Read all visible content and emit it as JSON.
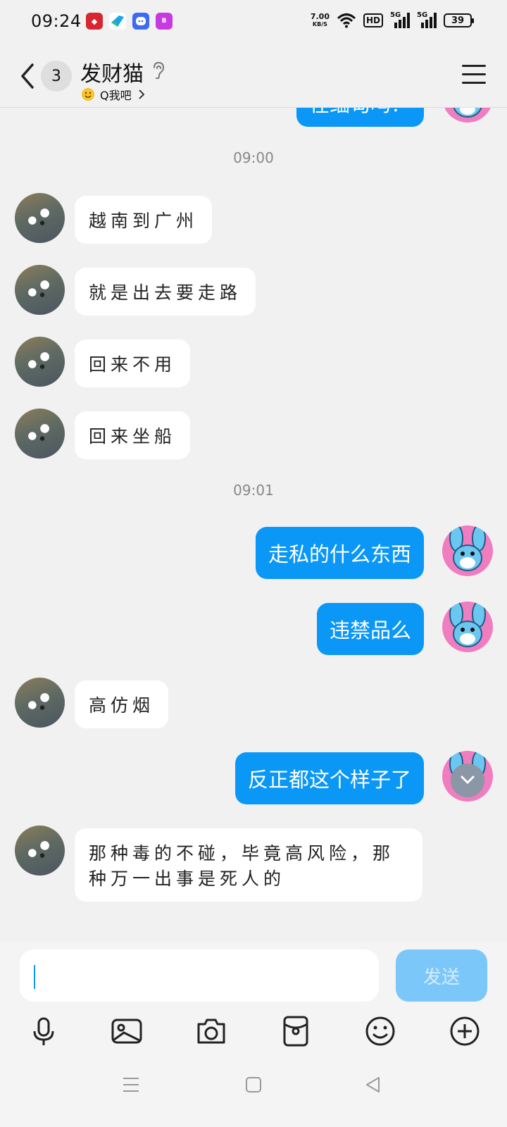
{
  "status_bar": {
    "time": "09:24",
    "net_speed_value": "7.00",
    "net_speed_unit": "KB/S",
    "hd_label": "HD",
    "sim1_label": "5G",
    "sim2_label": "5G",
    "battery": "39",
    "app_icons": [
      "app-icon-red",
      "app-icon-bird",
      "app-icon-qq",
      "app-icon-bank"
    ]
  },
  "header": {
    "unread_count": "3",
    "contact_name": "发财猫",
    "subtitle": "Q我吧"
  },
  "messages": [
    {
      "side": "right",
      "text": "在缅甸吗？",
      "partial": true
    },
    {
      "type": "timestamp",
      "text": "09:00"
    },
    {
      "side": "left",
      "text": "越南到广州"
    },
    {
      "side": "left",
      "text": "就是出去要走路"
    },
    {
      "side": "left",
      "text": "回来不用"
    },
    {
      "side": "left",
      "text": "回来坐船"
    },
    {
      "type": "timestamp",
      "text": "09:01"
    },
    {
      "side": "right",
      "text": "走私的什么东西"
    },
    {
      "side": "right",
      "text": "违禁品么"
    },
    {
      "side": "left",
      "text": "高仿烟"
    },
    {
      "side": "right",
      "text": "反正都这个样子了"
    },
    {
      "side": "left",
      "text": "那种毒的不碰，毕竟高风险，那种万一出事是死人的"
    }
  ],
  "input": {
    "value": "",
    "send_label": "发送"
  },
  "toolbar_icons": [
    "microphone-icon",
    "image-icon",
    "camera-icon",
    "red-packet-icon",
    "emoji-icon",
    "plus-icon"
  ],
  "colors": {
    "accent": "#0b97f6",
    "send_disabled": "#7cc7fa",
    "background": "#f1f1f1"
  }
}
